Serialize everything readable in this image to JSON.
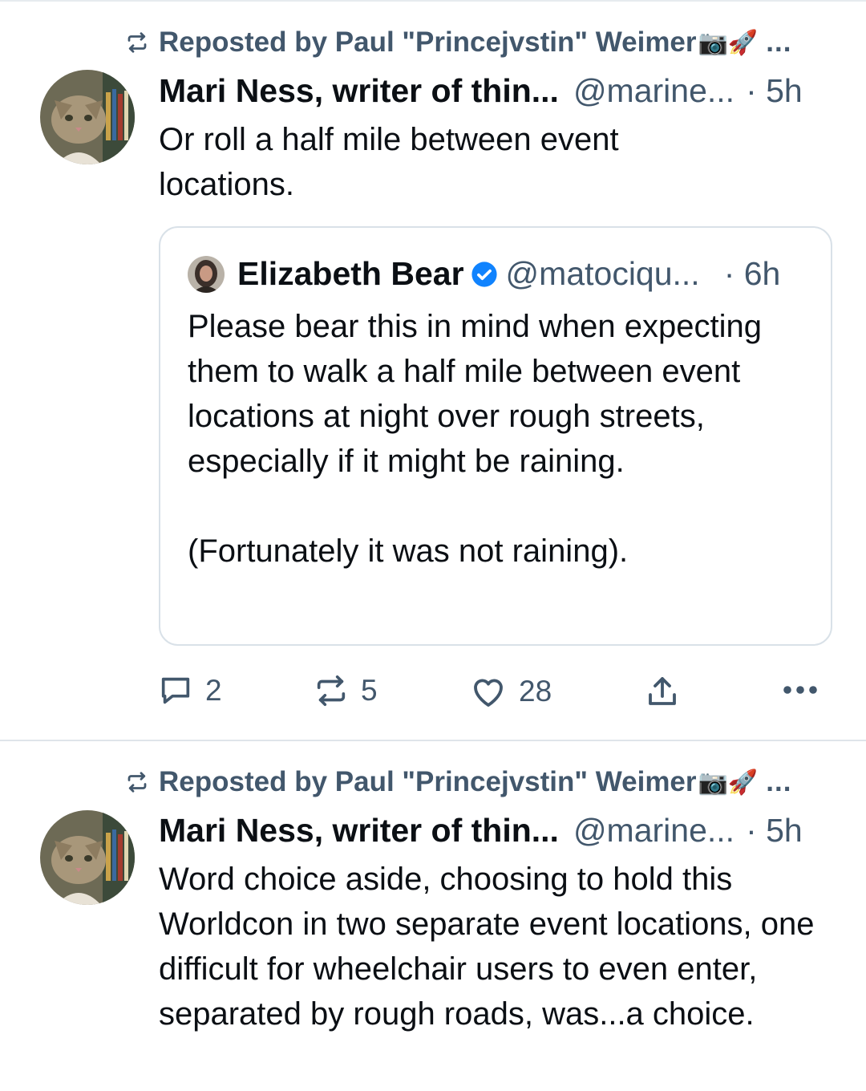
{
  "posts": [
    {
      "repost_text": "Reposted by Paul \"Princejvstin\" Weimer",
      "repost_emoji": "📷🚀",
      "repost_more": "...",
      "author_name": "Mari Ness, writer of thin...",
      "handle": "@marine...",
      "time": "· 5h",
      "text": "Or roll a half mile between event locations.",
      "quote": {
        "author_name": "Elizabeth Bear",
        "handle": "@matociqu...",
        "time": "· 6h",
        "text": "Please bear this in mind when expecting them to walk a half mile between event locations at night over rough streets, especially if it might be raining.\n\n(Fortunately it was not raining)."
      },
      "actions": {
        "replies": "2",
        "reposts": "5",
        "likes": "28"
      }
    },
    {
      "repost_text": "Reposted by Paul \"Princejvstin\" Weimer",
      "repost_emoji": "📷🚀",
      "repost_more": "...",
      "author_name": "Mari Ness, writer of thin...",
      "handle": "@marine...",
      "time": "· 5h",
      "text": "Word choice aside, choosing to hold this Worldcon in two separate event locations, one difficult for wheelchair users to even enter, separated by rough roads, was...a choice."
    }
  ],
  "icons": [
    "repost-icon",
    "verified-badge-icon",
    "reply-icon",
    "repost-icon",
    "like-heart-icon",
    "share-icon",
    "more-options-icon"
  ],
  "colors": {
    "muted": "#42576c",
    "text": "#0b0f14",
    "verified": "#1083fe",
    "border": "#d9e1e8"
  }
}
